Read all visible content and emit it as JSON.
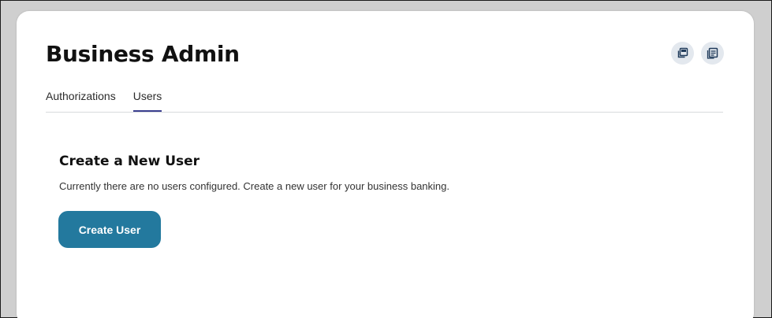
{
  "page": {
    "title": "Business Admin"
  },
  "header_actions": [
    {
      "icon": "copy-window-icon"
    },
    {
      "icon": "document-list-icon"
    }
  ],
  "tabs": [
    {
      "label": "Authorizations",
      "active": false
    },
    {
      "label": "Users",
      "active": true
    }
  ],
  "main": {
    "section_title": "Create a New User",
    "description": "Currently there are no users configured. Create a new user for your business banking.",
    "create_button_label": "Create User"
  },
  "colors": {
    "primary_button": "#23799e",
    "active_tab_underline": "#3b3f8f",
    "icon_button_bg": "#e3e8ee",
    "backdrop": "#cfcfcf"
  }
}
